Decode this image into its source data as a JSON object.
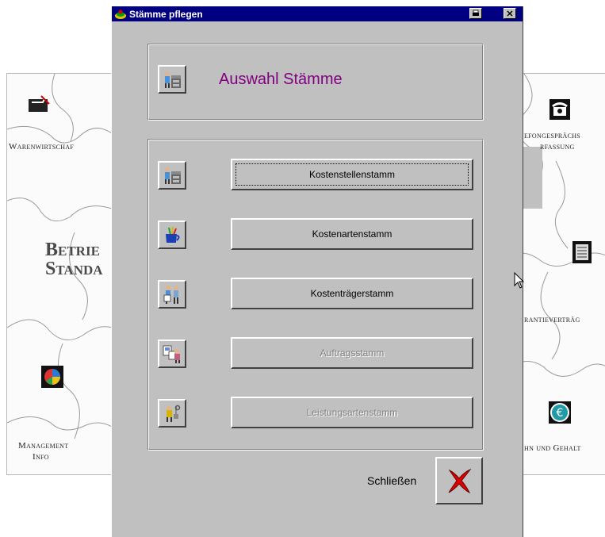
{
  "background": {
    "left_panel": {
      "warenwirtschaft": "Warenwirtschaf",
      "betrieb_line1": "Betrie",
      "betrieb_line2": "Standa",
      "management_line1": "Management",
      "management_line2": "Info"
    },
    "right_panel": {
      "telefon_line1": "efongesprächs",
      "telefon_line2": "rfassung",
      "garantie": "rantieverträg",
      "lohn": "hn und Gehalt"
    }
  },
  "dialog": {
    "title": "Stämme pflegen",
    "header_title": "Auswahl Stämme",
    "buttons": [
      {
        "label": "Kostenstellenstamm",
        "enabled": true,
        "focused": true,
        "icon": "people-at-desk-icon"
      },
      {
        "label": "Kostenartenstamm",
        "enabled": true,
        "focused": false,
        "icon": "cup-with-pencils-icon"
      },
      {
        "label": "Kostenträgerstamm",
        "enabled": true,
        "focused": false,
        "icon": "two-people-icon"
      },
      {
        "label": "Auftragsstamm",
        "enabled": false,
        "focused": false,
        "icon": "person-with-documents-icon"
      },
      {
        "label": "Leistungsartenstamm",
        "enabled": false,
        "focused": false,
        "icon": "worker-with-tools-icon"
      }
    ],
    "close_label": "Schließen"
  },
  "colors": {
    "titlebar": "#000080",
    "header_text": "#800080",
    "dialog_bg": "#c0c0c0",
    "close_x": "#e00000"
  }
}
